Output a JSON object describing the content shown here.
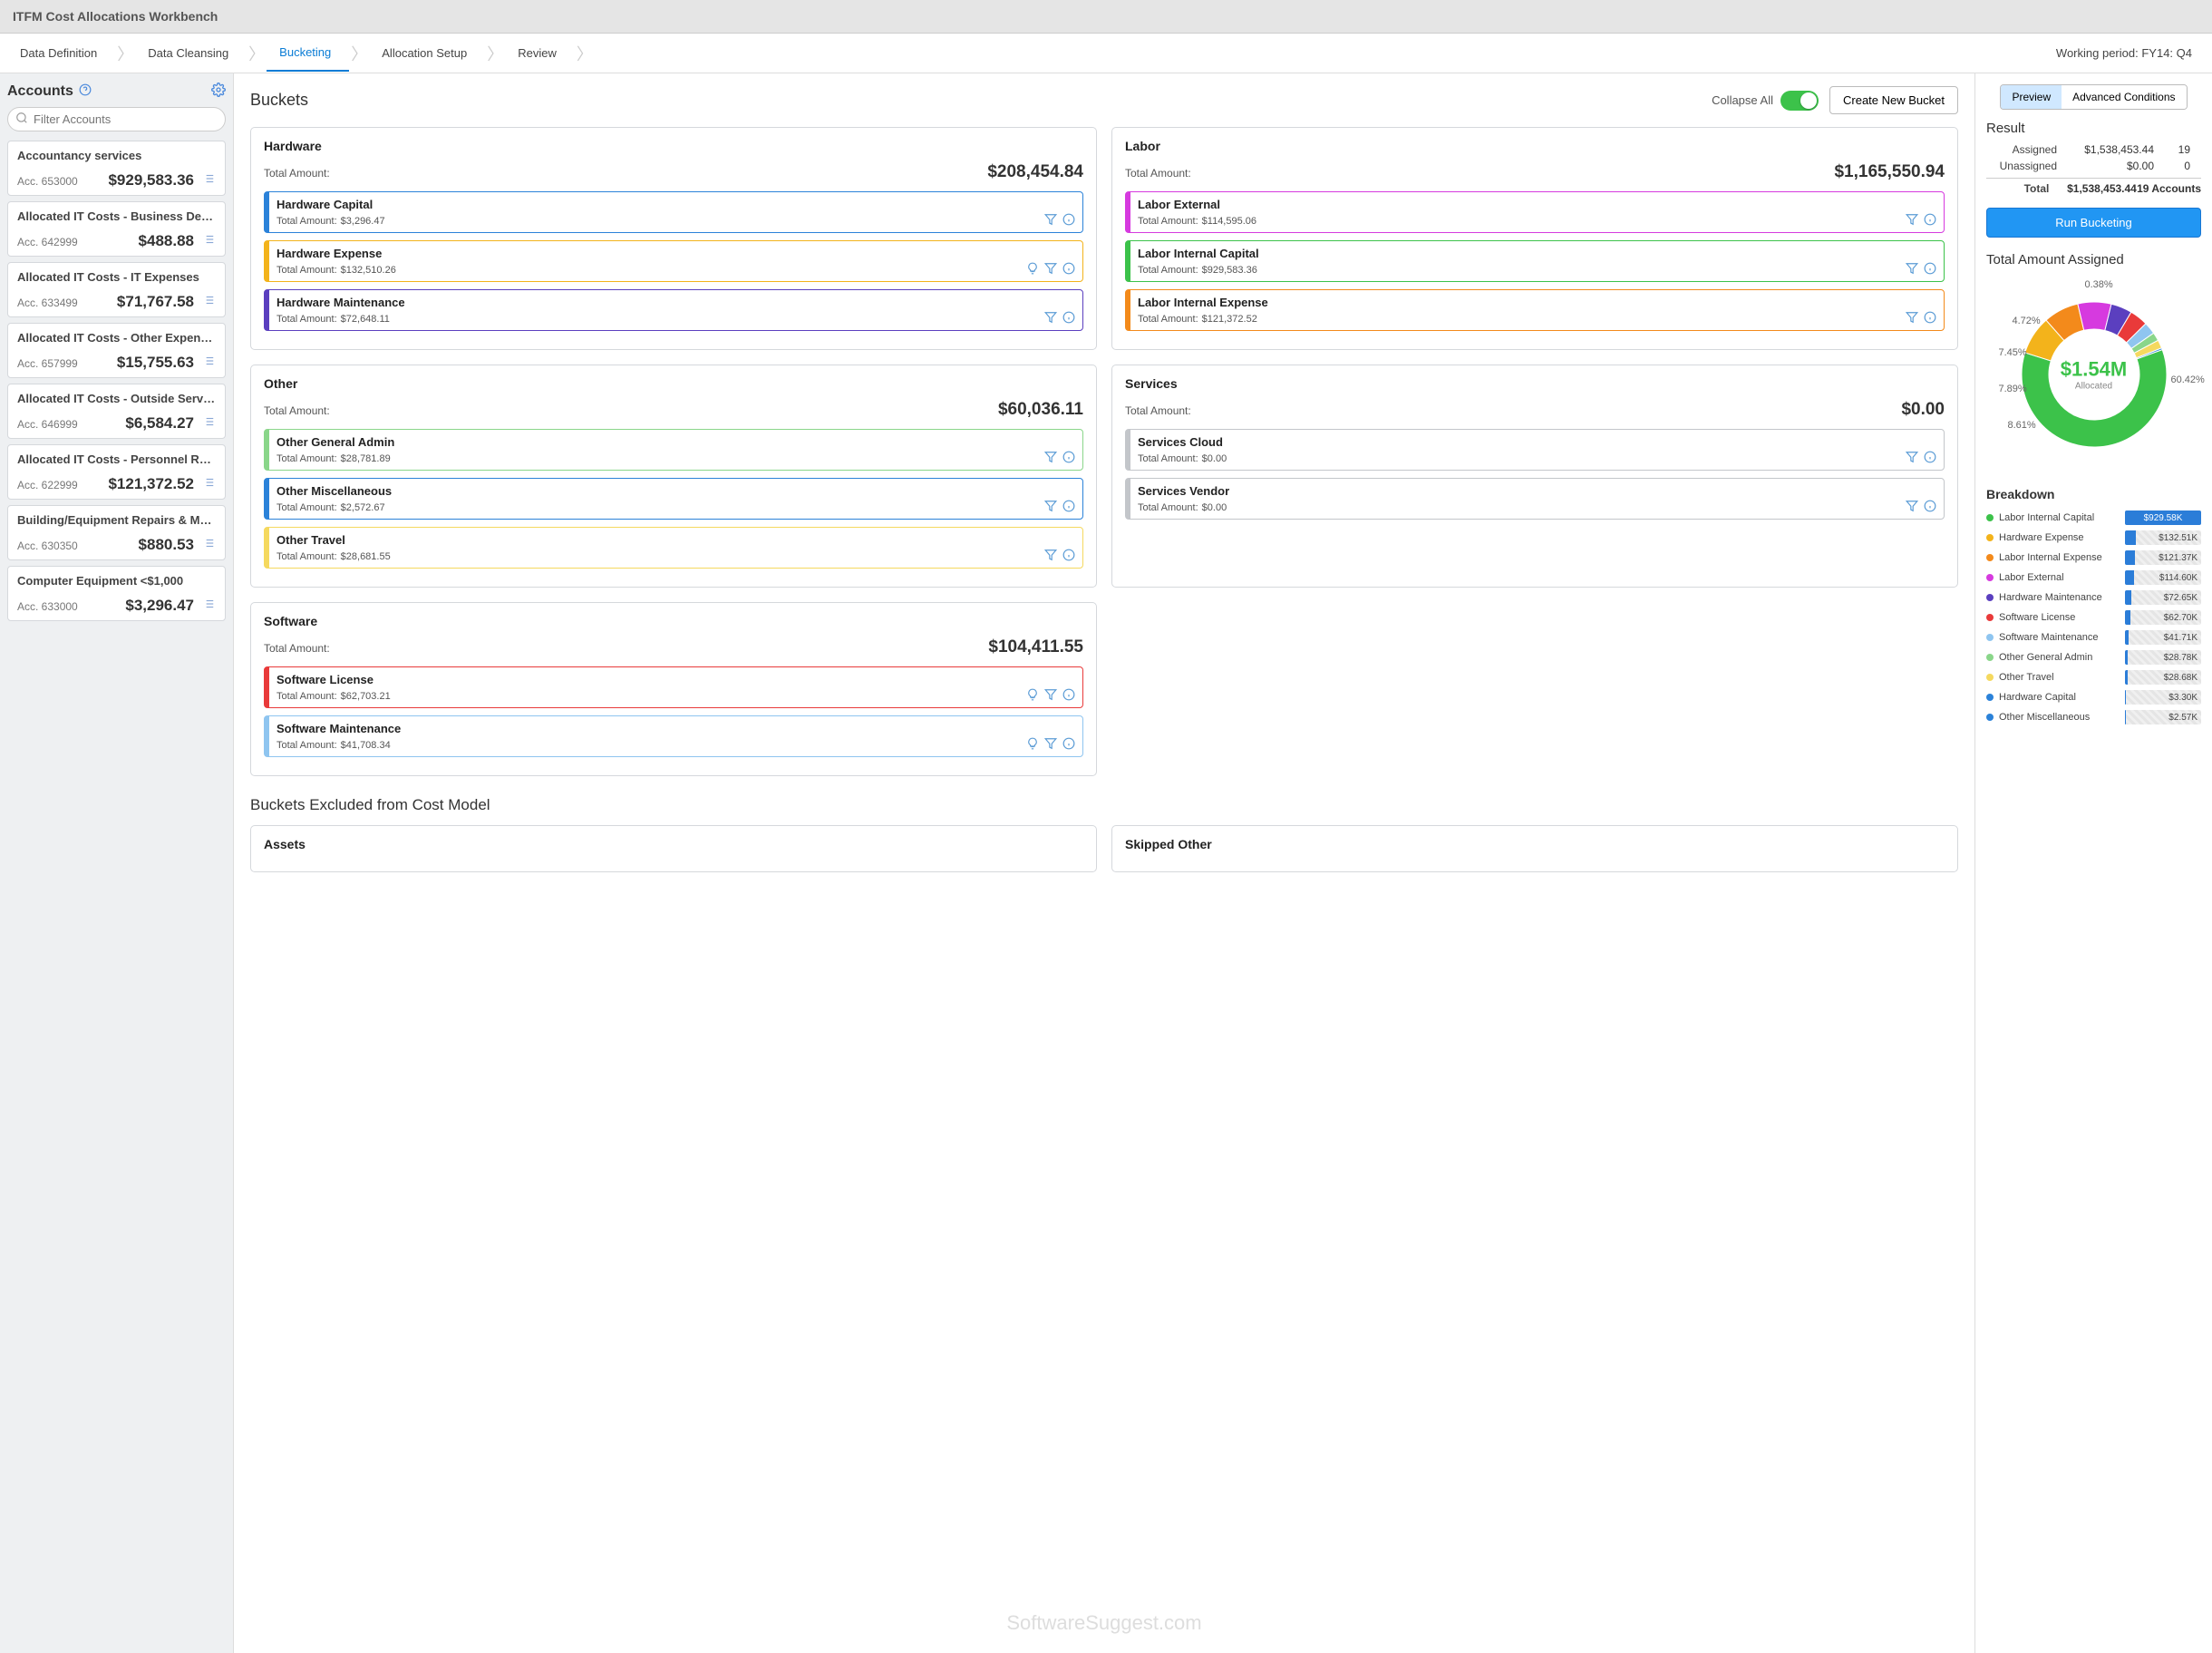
{
  "app_title": "ITFM Cost Allocations Workbench",
  "steps": [
    "Data Definition",
    "Data Cleansing",
    "Bucketing",
    "Allocation Setup",
    "Review"
  ],
  "active_step": 2,
  "working_period_label": "Working period:",
  "working_period_value": "FY14: Q4",
  "sidebar": {
    "title": "Accounts",
    "filter_placeholder": "Filter Accounts",
    "accounts": [
      {
        "name": "Accountancy services",
        "num": "Acc. 653000",
        "amt": "$929,583.36"
      },
      {
        "name": "Allocated IT Costs - Business Devel...",
        "num": "Acc. 642999",
        "amt": "$488.88"
      },
      {
        "name": "Allocated IT Costs - IT Expenses",
        "num": "Acc. 633499",
        "amt": "$71,767.58"
      },
      {
        "name": "Allocated IT Costs - Other Expenses",
        "num": "Acc. 657999",
        "amt": "$15,755.63"
      },
      {
        "name": "Allocated IT Costs - Outside Service...",
        "num": "Acc. 646999",
        "amt": "$6,584.27"
      },
      {
        "name": "Allocated IT Costs - Personnel Relat...",
        "num": "Acc. 622999",
        "amt": "$121,372.52"
      },
      {
        "name": "Building/Equipment Repairs & Maint...",
        "num": "Acc. 630350",
        "amt": "$880.53"
      },
      {
        "name": "Computer Equipment <$1,000",
        "num": "Acc. 633000",
        "amt": "$3,296.47"
      }
    ]
  },
  "center": {
    "title": "Buckets",
    "collapse_label": "Collapse All",
    "create_btn": "Create New Bucket",
    "excluded_title": "Buckets Excluded from Cost Model",
    "excluded_groups": [
      "Assets",
      "Skipped Other"
    ],
    "groups": [
      {
        "name": "Hardware",
        "total": "$208,454.84",
        "subs": [
          {
            "name": "Hardware Capital",
            "amt": "$3,296.47",
            "color": "#2b82d9"
          },
          {
            "name": "Hardware Expense",
            "amt": "$132,510.26",
            "color": "#f3b31b",
            "bulb": true
          },
          {
            "name": "Hardware Maintenance",
            "amt": "$72,648.11",
            "color": "#5b3fbf"
          }
        ]
      },
      {
        "name": "Labor",
        "total": "$1,165,550.94",
        "subs": [
          {
            "name": "Labor External",
            "amt": "$114,595.06",
            "color": "#d63adf"
          },
          {
            "name": "Labor Internal Capital",
            "amt": "$929,583.36",
            "color": "#3cc24a"
          },
          {
            "name": "Labor Internal Expense",
            "amt": "$121,372.52",
            "color": "#f38a1b"
          }
        ]
      },
      {
        "name": "Other",
        "total": "$60,036.11",
        "subs": [
          {
            "name": "Other General Admin",
            "amt": "$28,781.89",
            "color": "#8ad68a"
          },
          {
            "name": "Other Miscellaneous",
            "amt": "$2,572.67",
            "color": "#2b82d9"
          },
          {
            "name": "Other Travel",
            "amt": "$28,681.55",
            "color": "#f5d95f"
          }
        ]
      },
      {
        "name": "Services",
        "total": "$0.00",
        "subs": [
          {
            "name": "Services Cloud",
            "amt": "$0.00",
            "color": "#c3c6ca"
          },
          {
            "name": "Services Vendor",
            "amt": "$0.00",
            "color": "#c3c6ca"
          }
        ]
      },
      {
        "name": "Software",
        "total": "$104,411.55",
        "span2": true,
        "subs": [
          {
            "name": "Software License",
            "amt": "$62,703.21",
            "color": "#e93a3a",
            "bulb": true
          },
          {
            "name": "Software Maintenance",
            "amt": "$41,708.34",
            "color": "#8fc5f0",
            "bulb": true
          }
        ]
      }
    ]
  },
  "right": {
    "seg": [
      "Preview",
      "Advanced Conditions"
    ],
    "result_title": "Result",
    "rows": [
      {
        "lbl": "Assigned",
        "amt": "$1,538,453.44",
        "cnt": "19"
      },
      {
        "lbl": "Unassigned",
        "amt": "$0.00",
        "cnt": "0"
      }
    ],
    "total": {
      "lbl": "Total",
      "amt": "$1,538,453.44",
      "cnt": "19 Accounts"
    },
    "run_btn": "Run Bucketing",
    "chart_title": "Total Amount Assigned",
    "donut_center_val": "$1.54M",
    "donut_center_lbl": "Allocated",
    "breakdown_title": "Breakdown",
    "breakdown": [
      {
        "name": "Labor Internal Capital",
        "val": "$929.58K",
        "color": "#3cc24a",
        "pct": 100
      },
      {
        "name": "Hardware Expense",
        "val": "$132.51K",
        "color": "#f3b31b",
        "pct": 14
      },
      {
        "name": "Labor Internal Expense",
        "val": "$121.37K",
        "color": "#f38a1b",
        "pct": 13
      },
      {
        "name": "Labor External",
        "val": "$114.60K",
        "color": "#d63adf",
        "pct": 12
      },
      {
        "name": "Hardware Maintenance",
        "val": "$72.65K",
        "color": "#5b3fbf",
        "pct": 8
      },
      {
        "name": "Software License",
        "val": "$62.70K",
        "color": "#e93a3a",
        "pct": 7
      },
      {
        "name": "Software Maintenance",
        "val": "$41.71K",
        "color": "#8fc5f0",
        "pct": 5
      },
      {
        "name": "Other General Admin",
        "val": "$28.78K",
        "color": "#8ad68a",
        "pct": 3
      },
      {
        "name": "Other Travel",
        "val": "$28.68K",
        "color": "#f5d95f",
        "pct": 3
      },
      {
        "name": "Hardware Capital",
        "val": "$3.30K",
        "color": "#2b82d9",
        "pct": 1
      },
      {
        "name": "Other Miscellaneous",
        "val": "$2.57K",
        "color": "#2b82d9",
        "pct": 1
      }
    ]
  },
  "total_amount_label": "Total Amount:",
  "chart_data": {
    "type": "pie",
    "title": "Total Amount Assigned",
    "center_value": "$1.54M",
    "center_label": "Allocated",
    "slices": [
      {
        "label": "60.42%",
        "value": 60.42,
        "color": "#3cc24a",
        "name": "Labor Internal Capital"
      },
      {
        "label": "8.61%",
        "value": 8.61,
        "color": "#f3b31b",
        "name": "Hardware Expense"
      },
      {
        "label": "7.89%",
        "value": 7.89,
        "color": "#f38a1b",
        "name": "Labor Internal Expense"
      },
      {
        "label": "7.45%",
        "value": 7.45,
        "color": "#d63adf",
        "name": "Labor External"
      },
      {
        "label": "4.72%",
        "value": 4.72,
        "color": "#5b3fbf",
        "name": "Hardware Maintenance"
      },
      {
        "label": "0.38%",
        "value": 0.38,
        "color": "#f5d95f",
        "name": "Other Travel"
      },
      {
        "label": "",
        "value": 10.53,
        "color": "#mixed",
        "name": "remaining"
      }
    ],
    "visible_labels": [
      "60.42%",
      "8.61%",
      "7.89%",
      "7.45%",
      "4.72%",
      "0.38%"
    ]
  },
  "watermark": "SoftwareSuggest.com"
}
